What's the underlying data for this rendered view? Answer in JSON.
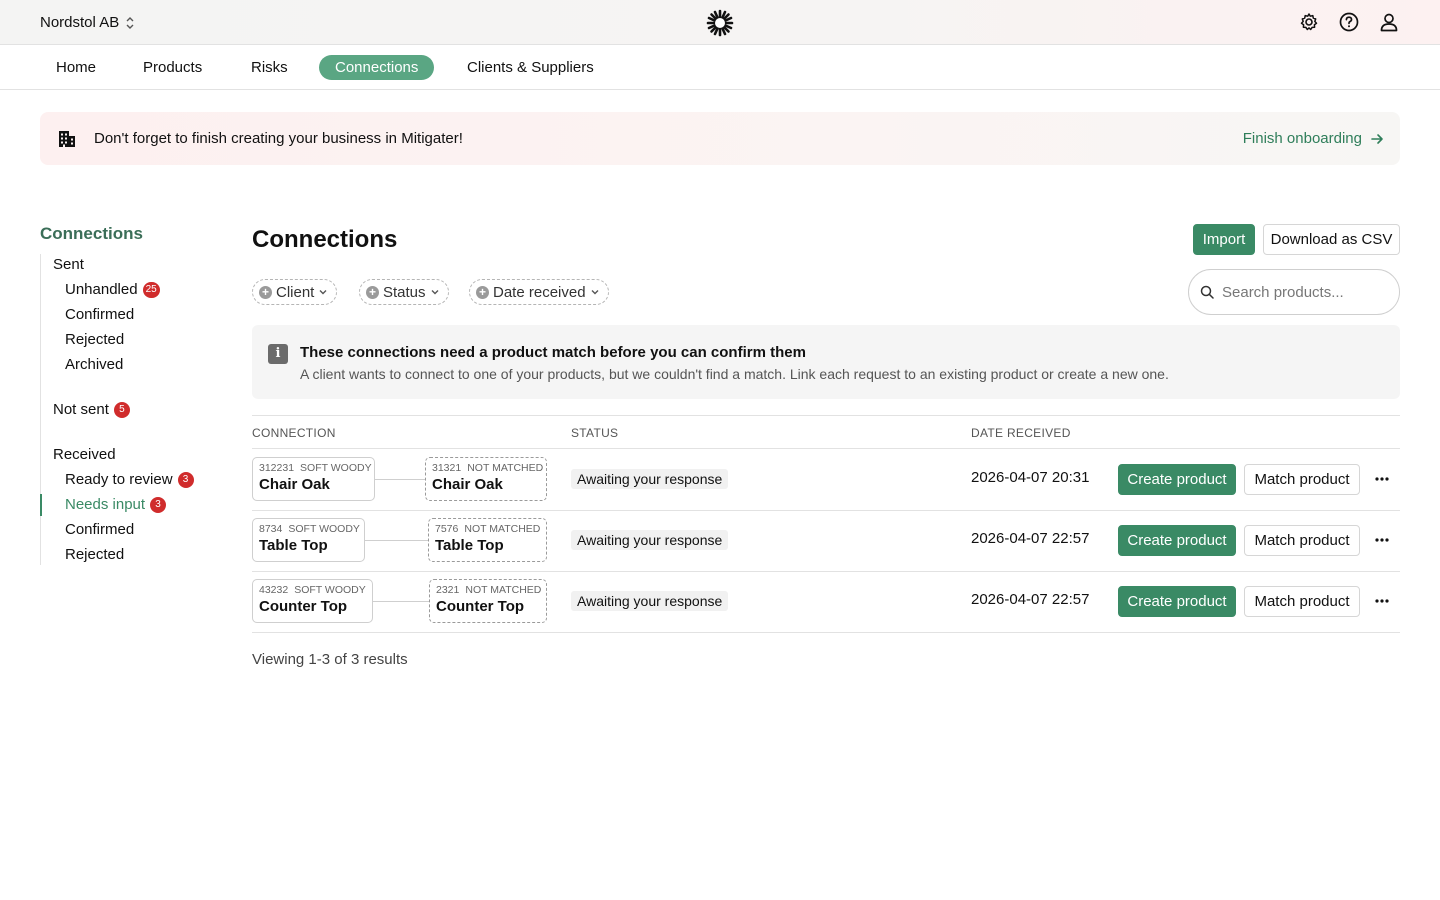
{
  "header": {
    "org_name": "Nordstol AB",
    "icons": [
      "settings-icon",
      "help-icon",
      "user-icon"
    ]
  },
  "nav": {
    "items": [
      "Home",
      "Products",
      "Risks",
      "Connections",
      "Clients & Suppliers"
    ],
    "active": "Connections"
  },
  "banner": {
    "text": "Don't forget to finish creating your business in Mitigater!",
    "link": "Finish onboarding"
  },
  "sidebar": {
    "title": "Connections",
    "groups": [
      {
        "label": "Sent",
        "items": [
          {
            "label": "Unhandled",
            "badge": "25"
          },
          {
            "label": "Confirmed"
          },
          {
            "label": "Rejected"
          },
          {
            "label": "Archived"
          }
        ]
      },
      {
        "label": "Not sent",
        "badge": "5",
        "items": []
      },
      {
        "label": "Received",
        "items": [
          {
            "label": "Ready to review",
            "badge": "3"
          },
          {
            "label": "Needs input",
            "badge": "3",
            "active": true
          },
          {
            "label": "Confirmed"
          },
          {
            "label": "Rejected"
          }
        ]
      }
    ]
  },
  "main": {
    "title": "Connections",
    "import_label": "Import",
    "csv_label": "Download as CSV",
    "filters": [
      "Client",
      "Status",
      "Date received"
    ],
    "search_placeholder": "Search products...",
    "info_title": "These connections need a product match before you can confirm them",
    "info_desc": "A client wants to connect to one of your products, but we couldn't find a match. Link each request to an existing product or create a new one.",
    "columns": [
      "CONNECTION",
      "STATUS",
      "DATE RECEIVED"
    ],
    "rows": [
      {
        "src_id": "312231",
        "src_tag": "SOFT WOODY",
        "src_name": "Chair Oak",
        "dst_id": "31321",
        "dst_tag": "NOT MATCHED",
        "dst_name": "Chair Oak",
        "status": "Awaiting your response",
        "date": "2026-04-07 20:31",
        "create_label": "Create product",
        "match_label": "Match product"
      },
      {
        "src_id": "8734",
        "src_tag": "SOFT WOODY",
        "src_name": "Table Top",
        "dst_id": "7576",
        "dst_tag": "NOT MATCHED",
        "dst_name": "Table Top",
        "status": "Awaiting your response",
        "date": "2026-04-07 22:57",
        "create_label": "Create product",
        "match_label": "Match product"
      },
      {
        "src_id": "43232",
        "src_tag": "SOFT WOODY",
        "src_name": "Counter Top",
        "dst_id": "2321",
        "dst_tag": "NOT MATCHED",
        "dst_name": "Counter Top",
        "status": "Awaiting your response",
        "date": "2026-04-07 22:57",
        "create_label": "Create product",
        "match_label": "Match product"
      }
    ],
    "results_text": "Viewing 1-3 of 3 results"
  },
  "colors": {
    "accent": "#3a8a65",
    "nav_active": "#5aa683",
    "badge": "#d02c2c"
  }
}
